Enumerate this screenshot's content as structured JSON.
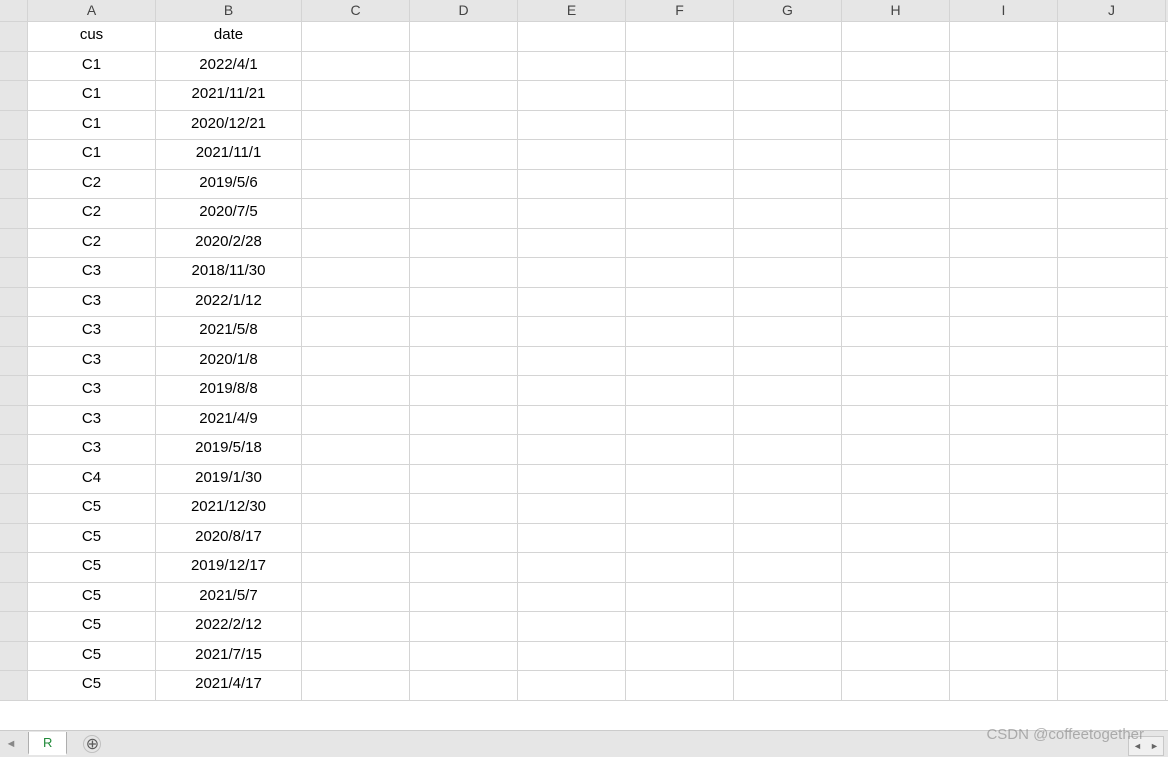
{
  "columns": [
    "",
    "A",
    "B",
    "C",
    "D",
    "E",
    "F",
    "G",
    "H",
    "I",
    "J",
    ""
  ],
  "rows": [
    {
      "A": "cus",
      "B": "date"
    },
    {
      "A": "C1",
      "B": "2022/4/1"
    },
    {
      "A": "C1",
      "B": "2021/11/21"
    },
    {
      "A": "C1",
      "B": "2020/12/21"
    },
    {
      "A": "C1",
      "B": "2021/11/1"
    },
    {
      "A": "C2",
      "B": "2019/5/6"
    },
    {
      "A": "C2",
      "B": "2020/7/5"
    },
    {
      "A": "C2",
      "B": "2020/2/28"
    },
    {
      "A": "C3",
      "B": "2018/11/30"
    },
    {
      "A": "C3",
      "B": "2022/1/12"
    },
    {
      "A": "C3",
      "B": "2021/5/8"
    },
    {
      "A": "C3",
      "B": "2020/1/8"
    },
    {
      "A": "C3",
      "B": "2019/8/8"
    },
    {
      "A": "C3",
      "B": "2021/4/9"
    },
    {
      "A": "C3",
      "B": "2019/5/18"
    },
    {
      "A": "C4",
      "B": "2019/1/30"
    },
    {
      "A": "C5",
      "B": "2021/12/30"
    },
    {
      "A": "C5",
      "B": "2020/8/17"
    },
    {
      "A": "C5",
      "B": "2019/12/17"
    },
    {
      "A": "C5",
      "B": "2021/5/7"
    },
    {
      "A": "C5",
      "B": "2022/2/12"
    },
    {
      "A": "C5",
      "B": "2021/7/15"
    },
    {
      "A": "C5",
      "B": "2021/4/17"
    }
  ],
  "tabbar": {
    "prev": "◄",
    "tab_name": "R",
    "add": "⊕"
  },
  "watermark": "CSDN @coffeetogether",
  "scroll_btn": {
    "left": "◄",
    "right": "►"
  }
}
